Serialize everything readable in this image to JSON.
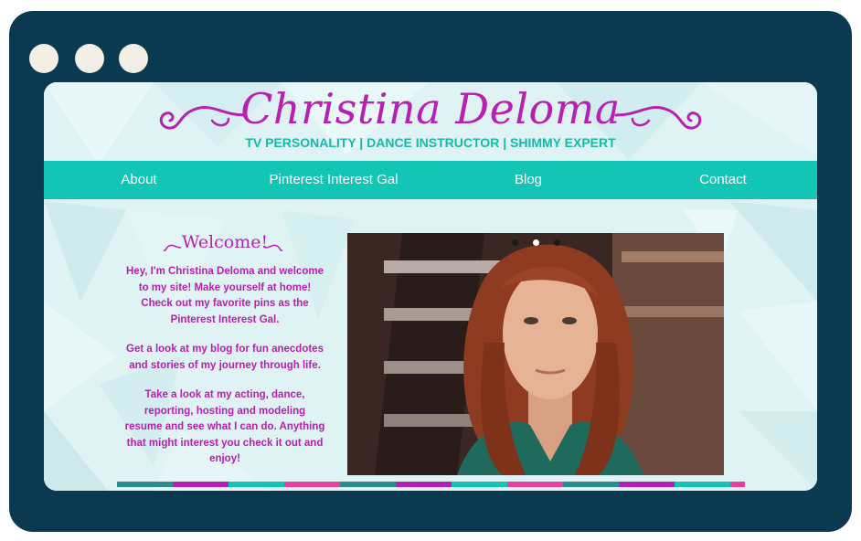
{
  "window": {
    "traffic_lights": [
      "dot",
      "dot",
      "dot"
    ]
  },
  "site": {
    "title": "Christina Deloma",
    "tagline": "TV PERSONALITY | DANCE INSTRUCTOR | SHIMMY EXPERT",
    "nav": [
      {
        "label": "About"
      },
      {
        "label": "Pinterest Interest Gal"
      },
      {
        "label": "Blog"
      },
      {
        "label": "Contact"
      }
    ]
  },
  "welcome": {
    "heading": "Welcome!",
    "paragraphs": [
      "Hey, I'm Christina Deloma and welcome to my site! Make yourself at home! Check out my favorite pins as the Pinterest Interest Gal.",
      "Get a look at my blog for fun anecdotes and stories of my journey through life.",
      "Take a look at my acting, dance, reporting, hosting and modeling resume and see what I can do. Anything that might interest you check it out and enjoy!"
    ]
  },
  "slideshow": {
    "image": "portrait-photo",
    "active_index": 1,
    "count": 3
  },
  "colors": {
    "frame": "#0b3a50",
    "magenta": "#b81fb3",
    "teal": "#12c5b4",
    "pink": "#ea3f9b",
    "background": "#dff3f5"
  }
}
